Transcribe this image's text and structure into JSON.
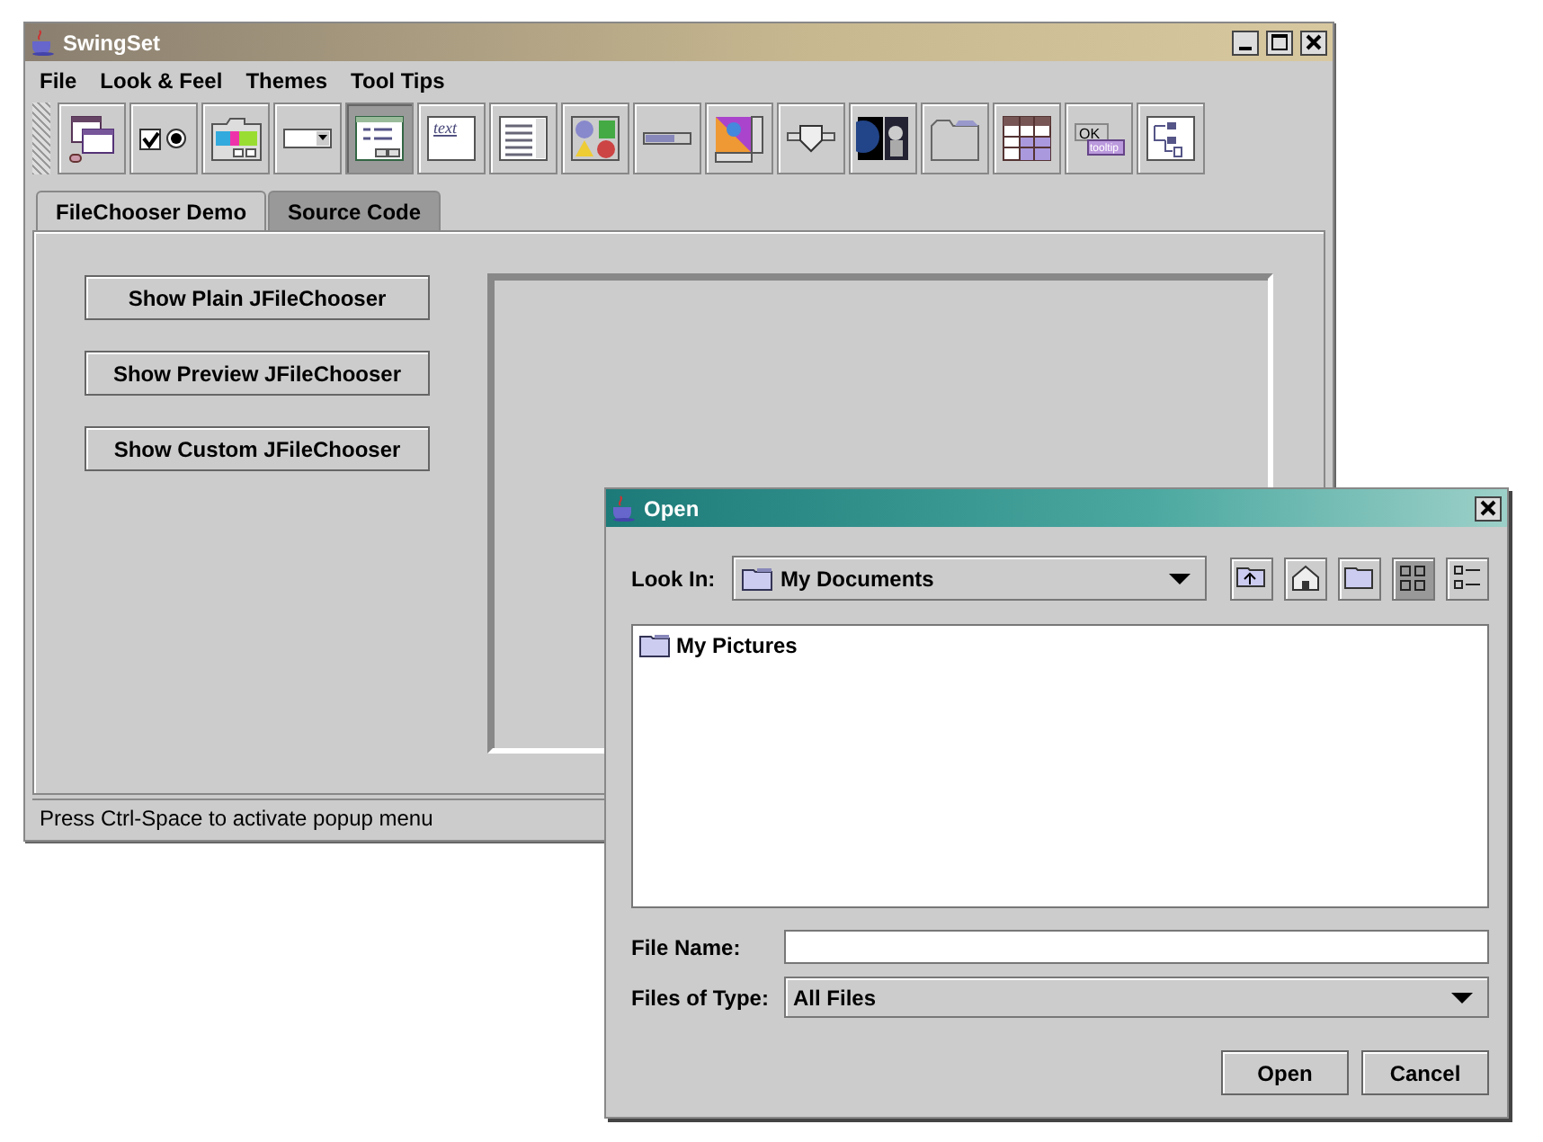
{
  "main_window": {
    "title": "SwingSet",
    "menu": [
      "File",
      "Look & Feel",
      "Themes",
      "Tool Tips"
    ],
    "toolbar": [
      {
        "kind": "frames",
        "selected": false
      },
      {
        "kind": "toggles",
        "selected": false
      },
      {
        "kind": "colors",
        "selected": false
      },
      {
        "kind": "combo",
        "selected": false
      },
      {
        "kind": "chooser",
        "selected": true
      },
      {
        "kind": "editor",
        "label": "text",
        "selected": false
      },
      {
        "kind": "list",
        "selected": false
      },
      {
        "kind": "dialogs",
        "selected": false
      },
      {
        "kind": "progress",
        "selected": false
      },
      {
        "kind": "scroll",
        "selected": false
      },
      {
        "kind": "slider",
        "selected": false
      },
      {
        "kind": "split",
        "selected": false
      },
      {
        "kind": "tabs",
        "selected": false
      },
      {
        "kind": "table",
        "selected": false
      },
      {
        "kind": "tooltip",
        "label": "OK",
        "tip": "tooltip",
        "selected": false
      },
      {
        "kind": "tree",
        "selected": false
      }
    ],
    "tabs": [
      {
        "label": "FileChooser Demo",
        "selected": true
      },
      {
        "label": "Source Code",
        "selected": false
      }
    ],
    "buttons": [
      "Show Plain JFileChooser",
      "Show Preview JFileChooser",
      "Show Custom JFileChooser"
    ],
    "status_bar": "Press Ctrl-Space to activate popup menu"
  },
  "dialog": {
    "title": "Open",
    "look_in": {
      "label": "Look In:",
      "value": "My Documents"
    },
    "view_buttons": [
      {
        "kind": "up",
        "selected": false
      },
      {
        "kind": "home",
        "selected": false
      },
      {
        "kind": "new-folder",
        "selected": false
      },
      {
        "kind": "icons",
        "selected": true
      },
      {
        "kind": "details",
        "selected": false
      }
    ],
    "files": [
      "My Pictures"
    ],
    "file_name": {
      "label": "File Name:"
    },
    "file_type": {
      "label": "Files of Type:",
      "value": "All Files"
    },
    "buttons": [
      "Open",
      "Cancel"
    ]
  }
}
